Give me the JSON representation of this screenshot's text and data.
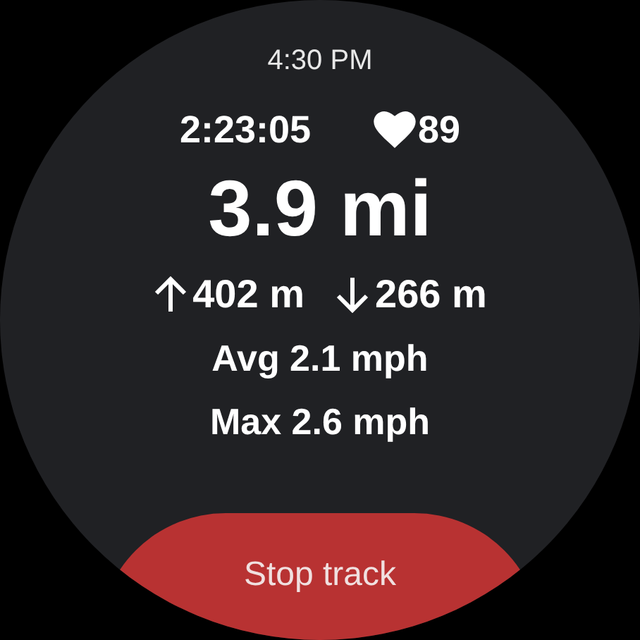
{
  "clock": "4:30 PM",
  "elapsed": "2:23:05",
  "heart_rate": "89",
  "distance": "3.9 mi",
  "ascent": "402 m",
  "descent": "266 m",
  "avg_speed": "Avg 2.1 mph",
  "max_speed": "Max 2.6 mph",
  "button": "Stop track"
}
